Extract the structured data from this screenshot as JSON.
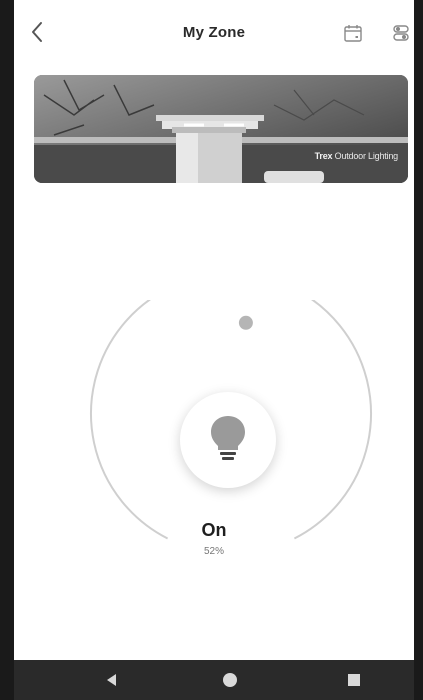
{
  "header": {
    "title": "My Zone",
    "back_icon": "chevron-left-icon",
    "calendar_icon": "calendar-icon",
    "settings_icon": "toggle-settings-icon"
  },
  "banner": {
    "brand": "Trex",
    "brand_tail": "Outdoor Lighting"
  },
  "light": {
    "state": "On",
    "level_label": "52%",
    "level": 0.52,
    "icon": "lightbulb-icon"
  },
  "navbar": {
    "back_icon": "triangle-back-icon",
    "home_icon": "circle-home-icon",
    "recents_icon": "square-recents-icon"
  },
  "colors": {
    "background": "#ffffff",
    "ring": "#cfcfcf",
    "knob": "#b5b5b5",
    "navbar": "#2a2a2a",
    "icon_gray": "#888888"
  }
}
